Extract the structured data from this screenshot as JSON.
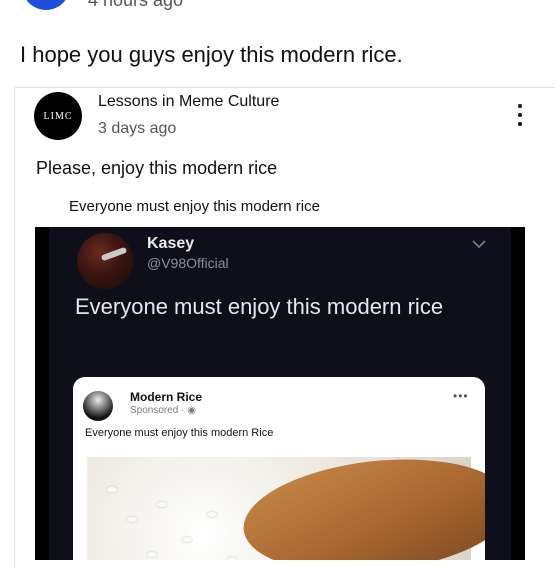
{
  "post": {
    "time": "4 hours ago",
    "text": "I hope you guys enjoy this modern rice."
  },
  "shared": {
    "avatar_text": "LIMC",
    "channel": "Lessons in Meme Culture",
    "time": "3 days ago",
    "caption": "Please, enjoy this modern rice"
  },
  "image": {
    "header": "Everyone must enjoy this modern rice",
    "tweet": {
      "name": "Kasey",
      "handle": "@V98Official",
      "text": "Everyone must enjoy this modern rice"
    },
    "ad": {
      "name": "Modern Rice",
      "sponsored": "Sponsored · ◉",
      "caption": "Everyone must enjoy this modern Rice",
      "dots": "•••"
    }
  },
  "icons": {
    "more": "vertical-dots",
    "chevron": "chevron-down"
  },
  "colors": {
    "image_bg": "#0e0f1a",
    "top_avatar": "#1d4ed8"
  }
}
